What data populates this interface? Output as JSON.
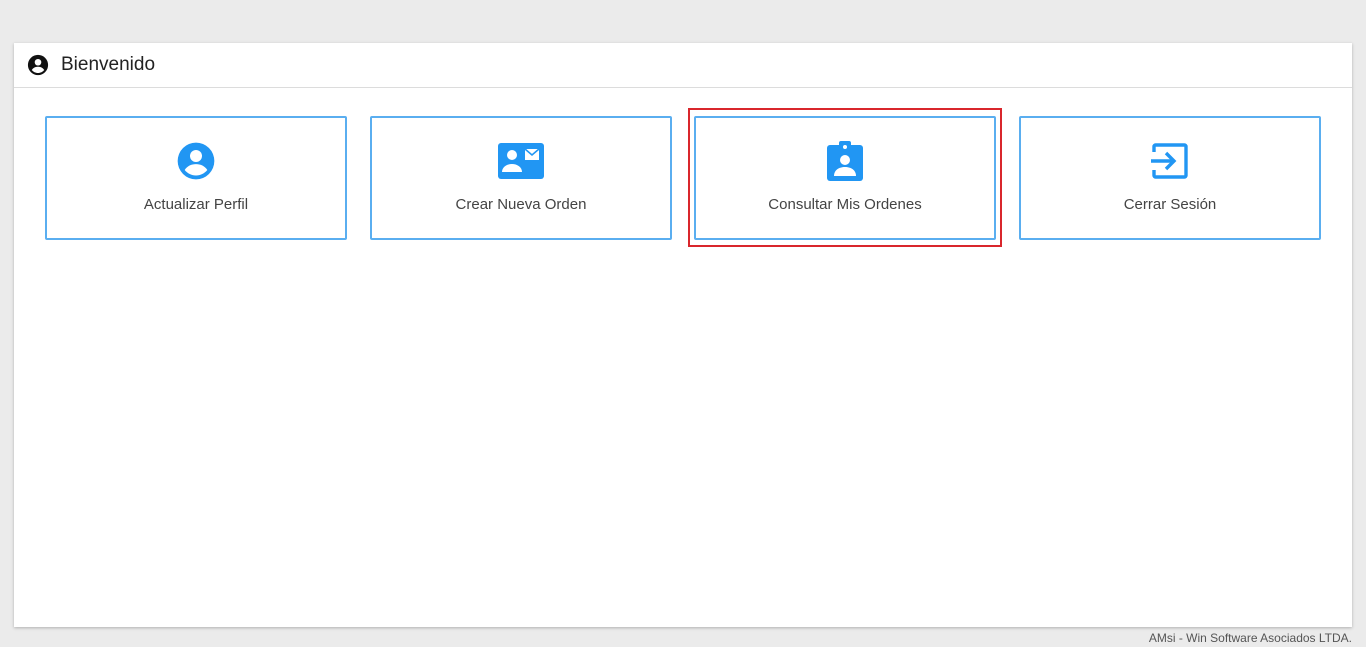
{
  "header": {
    "title": "Bienvenido",
    "icon": "account-circle-icon"
  },
  "tiles": [
    {
      "label": "Actualizar Perfil",
      "icon": "account-circle-icon"
    },
    {
      "label": "Crear Nueva Orden",
      "icon": "contact-mail-icon"
    },
    {
      "label": "Consultar Mis Ordenes",
      "icon": "assignment-ind-icon",
      "highlighted": true
    },
    {
      "label": "Cerrar Sesión",
      "icon": "exit-to-app-icon"
    }
  ],
  "footer": {
    "text": "AMsi - Win Software Asociados LTDA."
  },
  "colors": {
    "accent": "#2196f3",
    "tile_border": "#5aaef0",
    "highlight": "#d9262c",
    "background": "#ebebeb"
  }
}
